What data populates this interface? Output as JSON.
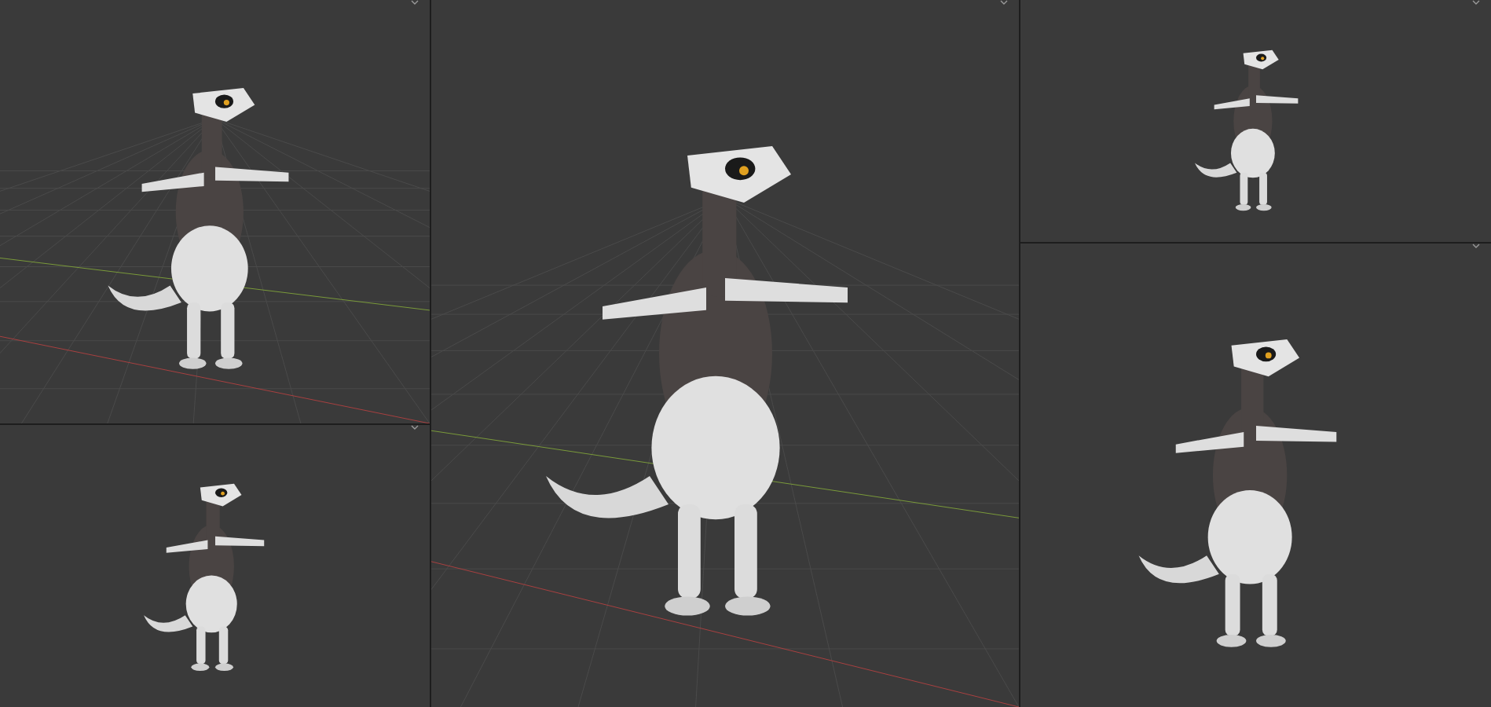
{
  "viewports": [
    {
      "kind": "perspective"
    },
    {
      "kind": "orthographic"
    },
    {
      "kind": "perspective"
    },
    {
      "kind": "orthographic"
    },
    {
      "kind": "orthographic"
    }
  ]
}
